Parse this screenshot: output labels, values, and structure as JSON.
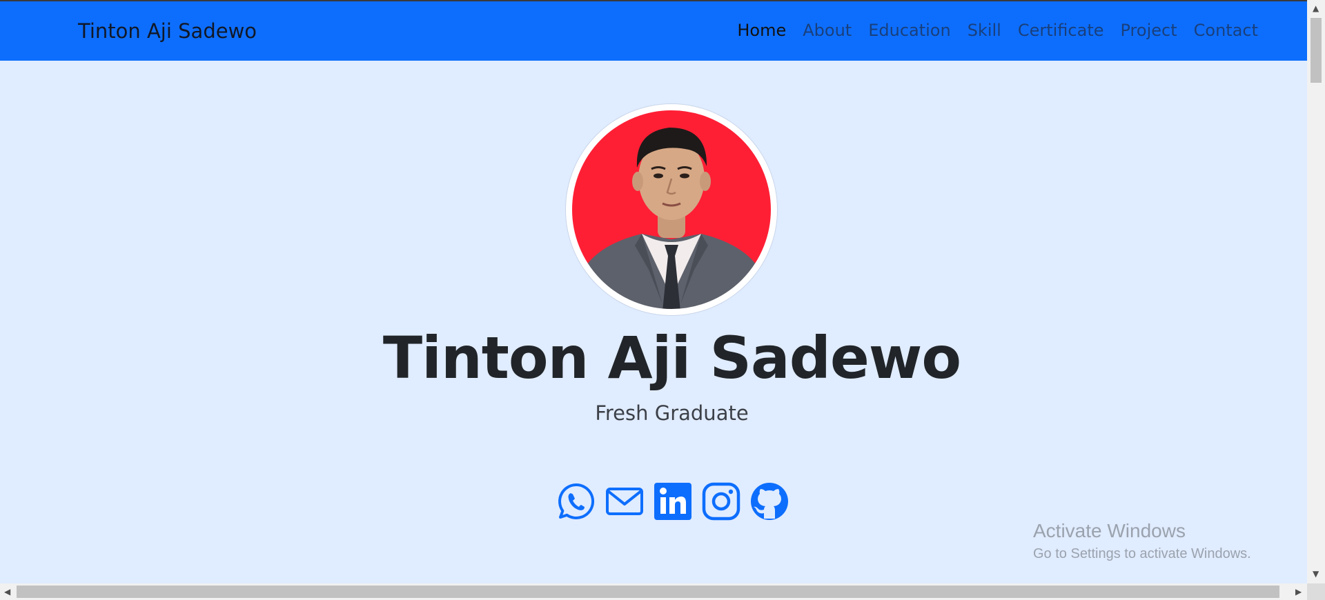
{
  "navbar": {
    "brand": "Tinton Aji Sadewo",
    "links": [
      "Home",
      "About",
      "Education",
      "Skill",
      "Certificate",
      "Project",
      "Contact"
    ],
    "active": "Home",
    "bg_color": "#0d6efd"
  },
  "hero": {
    "name": "Tinton Aji Sadewo",
    "role": "Fresh Graduate",
    "avatar_bg_color": "#ff1f35"
  },
  "socials": [
    {
      "name": "whatsapp-icon"
    },
    {
      "name": "email-icon"
    },
    {
      "name": "linkedin-icon"
    },
    {
      "name": "instagram-icon"
    },
    {
      "name": "github-icon"
    }
  ],
  "watermark": {
    "title": "Activate Windows",
    "subtitle": "Go to Settings to activate Windows."
  },
  "colors": {
    "page_bg": "#e0ecff",
    "accent": "#0d6efd",
    "text": "#212529"
  }
}
